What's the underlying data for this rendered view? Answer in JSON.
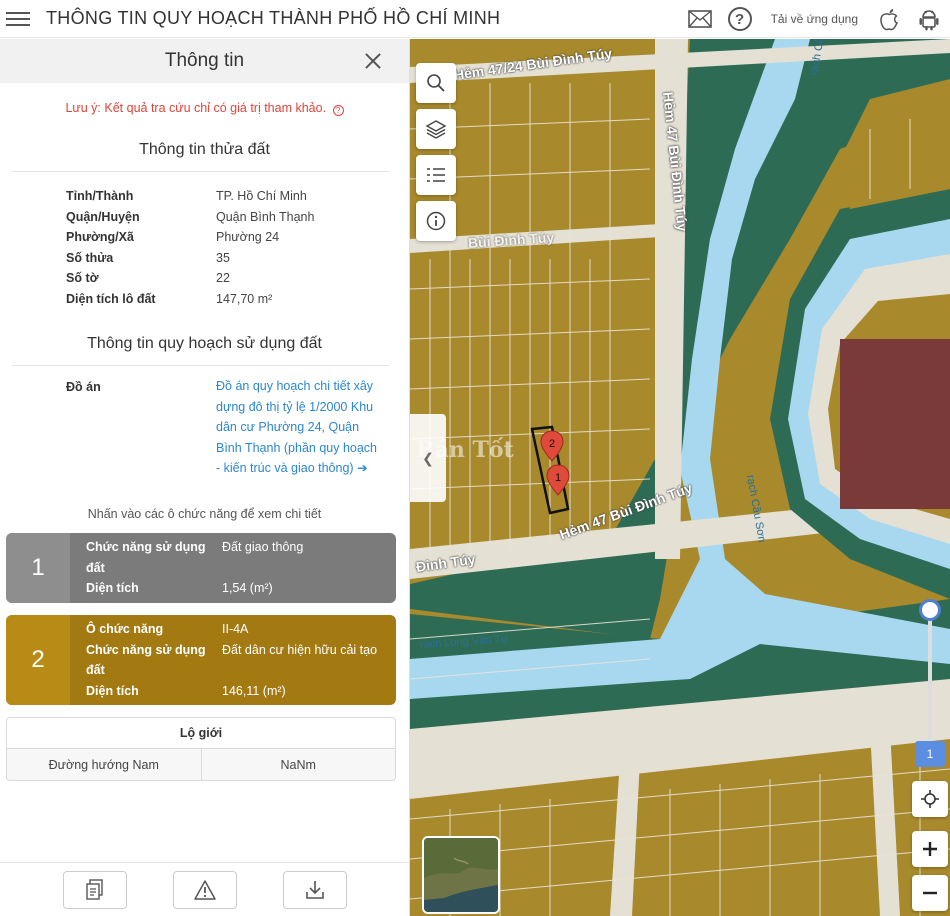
{
  "header": {
    "title": "THÔNG TIN QUY HOẠCH THÀNH PHỐ HỒ CHÍ MINH",
    "download_label": "Tải về ứng dụng",
    "help_glyph": "?"
  },
  "panel": {
    "title": "Thông tin",
    "note": "Lưu ý: Kết quả tra cứu chỉ có giá trị tham khảo.",
    "note_glyph": "?",
    "parcel_section_title": "Thông tin thửa đất",
    "parcel": [
      {
        "key": "Tỉnh/Thành",
        "value": "TP. Hồ Chí Minh"
      },
      {
        "key": "Quận/Huyện",
        "value": "Quận Bình Thạnh"
      },
      {
        "key": "Phường/Xã",
        "value": "Phường 24"
      },
      {
        "key": "Số thửa",
        "value": "35"
      },
      {
        "key": "Số tờ",
        "value": "22"
      },
      {
        "key": "Diện tích lô đất",
        "value": "147,70 m²"
      }
    ],
    "plan_section_title": "Thông tin quy hoạch sử dụng đất",
    "plan_key": "Đồ án",
    "plan_value": "Đồ án quy hoạch chi tiết xây dựng đô thị tỷ lệ 1/2000 Khu dân cư Phường 24, Quận Bình Thạnh (phần quy hoạch - kiến trúc và giao thông)",
    "plan_arrow": "➔",
    "hint": "Nhấn vào các ô chức năng để xem chi tiết",
    "functions": [
      {
        "num": "1",
        "color": "#7b7b7b",
        "rows": [
          {
            "key": "Chức năng sử dụng đất",
            "value": "Đất giao thông"
          },
          {
            "key": "Diện tích",
            "value": "1,54 (m²)"
          }
        ]
      },
      {
        "num": "2",
        "color": "#a37a12",
        "rows": [
          {
            "key": "Ô chức năng",
            "value": "II-4A"
          },
          {
            "key": "Chức năng sử dụng đất",
            "value": "Đất dân cư hiện hữu cải tạo"
          },
          {
            "key": "Diện tích",
            "value": "146,11 (m²)"
          }
        ]
      }
    ],
    "lo_gioi": {
      "title": "Lộ giới",
      "direction": "Đường hướng Nam",
      "value": "NaNm"
    }
  },
  "map": {
    "roads": [
      "Hẻm 47/24 Bùi Đình Túy",
      "Hẻm 47 Bùi Đình Túy",
      "Hẻm 47 Bùi Đình Túy",
      "Đinh Túy",
      "Bùi Đình Túy"
    ],
    "rivers": [
      "rạch Long Vân Tự",
      "rạch Cầu Sơn",
      "rạch Cầu"
    ],
    "watermark": "Bán Tốt",
    "markers": [
      "2",
      "1"
    ],
    "zoom_value": "1",
    "colors": {
      "residential": "#a88a2c",
      "green": "#2e6b55",
      "water": "#a8d8f0",
      "road": "#e4e0d4",
      "special": "#7a3a3a"
    }
  }
}
